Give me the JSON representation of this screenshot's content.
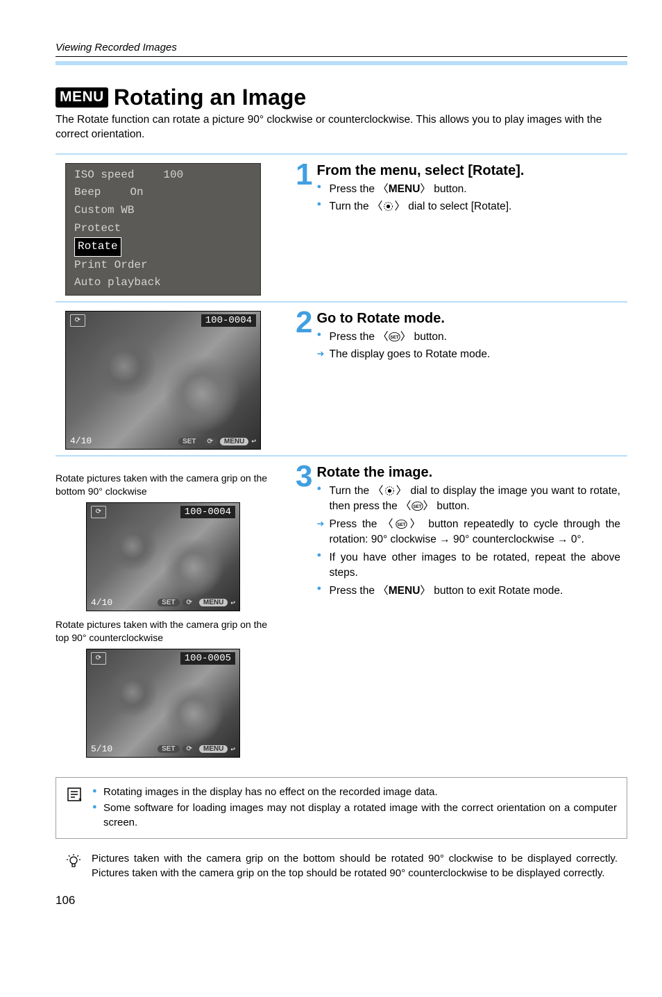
{
  "header": {
    "breadcrumb": "Viewing Recorded Images"
  },
  "title": {
    "badge": "MENU",
    "text": "Rotating an Image"
  },
  "intro": "The Rotate function can rotate a picture 90° clockwise or counterclockwise. This allows you to play images with the correct orientation.",
  "menu": {
    "items": [
      {
        "label": "ISO speed",
        "value": "100"
      },
      {
        "label": "Beep",
        "value": "On"
      },
      {
        "label": "Custom WB",
        "value": ""
      },
      {
        "label": "Protect",
        "value": ""
      },
      {
        "label": "Rotate",
        "value": "",
        "selected": true
      },
      {
        "label": "Print Order",
        "value": ""
      },
      {
        "label": "Auto playback",
        "value": ""
      }
    ]
  },
  "steps": [
    {
      "num": "1",
      "title": "From the menu, select [Rotate].",
      "bullets": [
        {
          "type": "dot",
          "pre": "Press the 〈",
          "icon": "menubold",
          "post": "〉 button."
        },
        {
          "type": "dot",
          "pre": "Turn the 〈",
          "icon": "dial",
          "post": "〉 dial to select [Rotate]."
        }
      ]
    },
    {
      "num": "2",
      "title": "Go to Rotate mode.",
      "bullets": [
        {
          "type": "dot",
          "pre": "Press the 〈",
          "icon": "set",
          "post": "〉 button."
        },
        {
          "type": "arrow",
          "text": "The display goes to Rotate mode."
        }
      ],
      "preview": {
        "id": "100-0004",
        "counter": "4/10"
      }
    },
    {
      "num": "3",
      "title": "Rotate the image.",
      "bullets": [
        {
          "type": "dot",
          "pre": "Turn the 〈",
          "icon": "dial",
          "post": "〉 dial to display the image you want to rotate, then press the 〈",
          "icon2": "set",
          "post2": "〉 button."
        },
        {
          "type": "arrow",
          "pre": "Press the 〈",
          "icon": "set",
          "post": "〉 button repeatedly to cycle through the rotation: 90° clockwise → 90° counterclockwise → 0°."
        },
        {
          "type": "dot",
          "text": "If you have other images to be rotated, repeat the above steps."
        },
        {
          "type": "dot",
          "pre": "Press the 〈",
          "icon": "menubold",
          "post": "〉 button to exit Rotate mode."
        }
      ],
      "captions": [
        "Rotate pictures taken with the camera grip on the bottom 90° clockwise",
        "Rotate pictures taken with the camera grip on the top 90° counterclockwise"
      ],
      "previews": [
        {
          "id": "100-0004",
          "counter": "4/10"
        },
        {
          "id": "100-0005",
          "counter": "5/10"
        }
      ]
    }
  ],
  "notes": {
    "box": [
      "Rotating images in the display has no effect on the recorded image data.",
      "Some software for loading images may not display a rotated image with the correct orientation on a computer screen."
    ],
    "tip": "Pictures taken with the camera grip on the bottom should be rotated 90° clockwise to be displayed correctly. Pictures taken with the camera grip on the top should be rotated 90° counterclockwise to be displayed correctly."
  },
  "page_number": "106",
  "ui": {
    "set_label": "SET",
    "menu_pill": "MENU",
    "return_glyph": "↩",
    "rotate_glyph": "⟳",
    "menu_bold": "MENU"
  }
}
